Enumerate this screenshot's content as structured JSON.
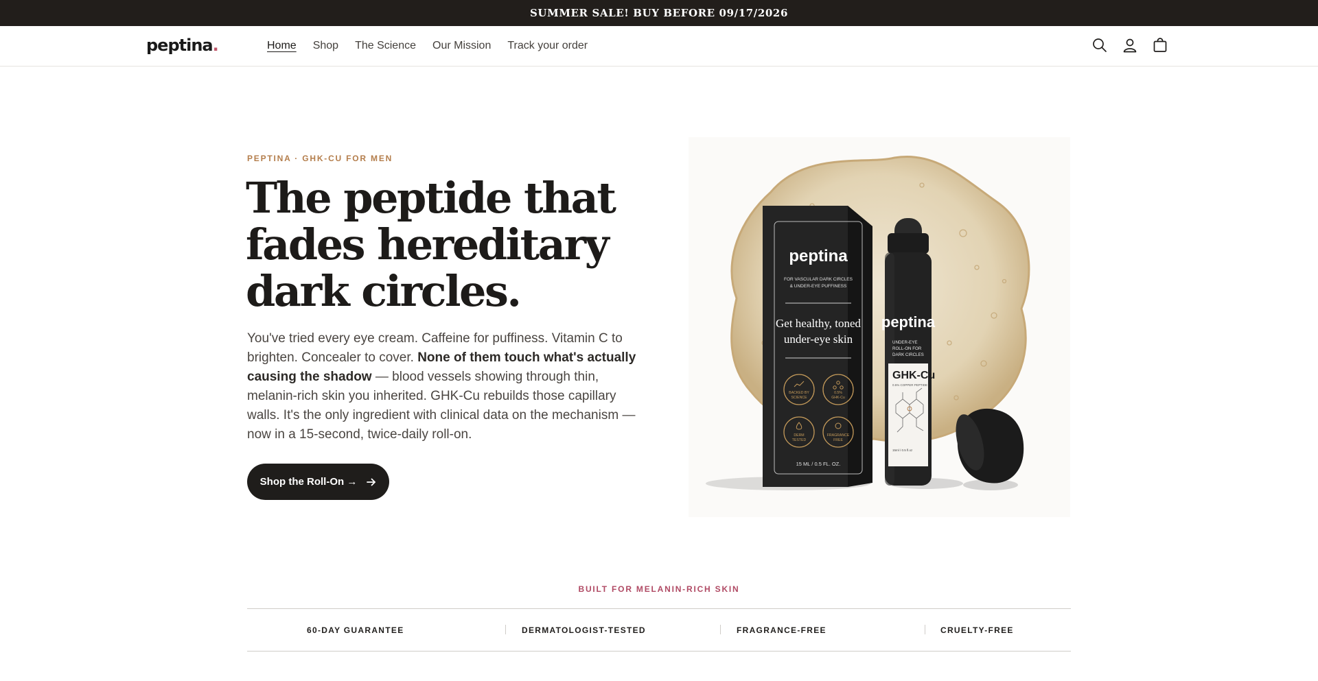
{
  "announcement": {
    "text": "SUMMER SALE! BUY BEFORE 09/17/2026"
  },
  "header": {
    "logo": "peptina",
    "logo_dot": ".",
    "nav": [
      "Home",
      "Shop",
      "The Science",
      "Our Mission",
      "Track your order"
    ],
    "active_nav": "Home",
    "icons": [
      "search-icon",
      "account-icon",
      "cart-icon"
    ]
  },
  "hero": {
    "eyebrow": "PEPTINA · GHK-CU FOR MEN",
    "headline_lines": [
      "The peptide that",
      "fades hereditary",
      "dark circles."
    ],
    "body_intro": "You've tried every eye cream. Caffeine for puffiness. Vitamin C to brighten. Concealer to cover. ",
    "body_bold": "None of them touch what's actually causing the shadow",
    "body_rest": " — blood vessels showing through thin, melanin-rich skin you inherited. GHK-Cu rebuilds those capillary walls. It's the only ingredient with clinical data on the mechanism — now in a 15-second, twice-daily roll-on.",
    "cta_label": "Shop the Roll-On →",
    "product": {
      "brand": "peptina",
      "box_subtitle_1": "FOR VASCULAR DARK CIRCLES",
      "box_subtitle_2": "& UNDER-EYE PUFFINESS",
      "box_tagline_1": "Get healthy, toned",
      "box_tagline_2": "under-eye skin",
      "badges": [
        [
          "BACKED BY",
          "SCIENCE"
        ],
        [
          "0.5%",
          "GHK-Cu"
        ],
        [
          "DERM",
          "TESTED"
        ],
        [
          "FRAGRANCE",
          "FREE"
        ]
      ],
      "box_volume": "15 ML / 0.5 FL. OZ.",
      "bottle_desc": [
        "UNDER-EYE",
        "ROLL-ON FOR",
        "DARK CIRCLES"
      ],
      "bottle_name": "GHK-Cu",
      "bottle_sub": "0.5% COPPER PEPTIDE",
      "bottle_volume": "15ml / 0.5 fl.oz"
    }
  },
  "trust": {
    "title": "BUILT FOR MELANIN-RICH SKIN",
    "items": [
      "60-DAY GUARANTEE",
      "DERMATOLOGIST-TESTED",
      "FRAGRANCE-FREE",
      "CRUELTY-FREE"
    ]
  },
  "colors": {
    "announcement_bg": "#221e1b",
    "eyebrow": "#b47e4c",
    "accent_pink": "#b04a64",
    "cta_bg": "#1f1d1b",
    "gold": "#c49a5a"
  }
}
